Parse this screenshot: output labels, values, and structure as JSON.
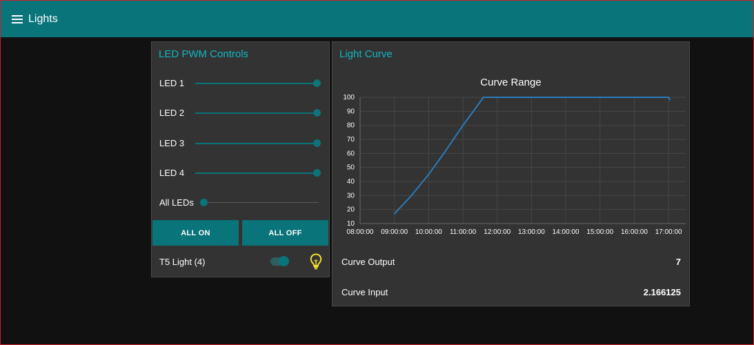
{
  "header": {
    "title": "Lights",
    "menu_icon": "hamburger-menu-icon"
  },
  "led_card": {
    "title": "LED PWM Controls",
    "sliders": [
      {
        "label": "LED 1",
        "value_fraction": 1.0
      },
      {
        "label": "LED 2",
        "value_fraction": 1.0
      },
      {
        "label": "LED 3",
        "value_fraction": 1.0
      },
      {
        "label": "LED 4",
        "value_fraction": 1.0
      },
      {
        "label": "All LEDs",
        "value_fraction": 0.0
      }
    ],
    "all_on_label": "ALL ON",
    "all_off_label": "ALL OFF",
    "t5_label": "T5 Light (4)",
    "t5_state": "on",
    "bulb_icon": "lightbulb-icon",
    "bulb_color": "#f5e12a"
  },
  "curve_card": {
    "title": "Light Curve",
    "curve_output_label": "Curve Output",
    "curve_output_value": "7",
    "curve_input_label": "Curve Input",
    "curve_input_value": "2.166125"
  },
  "colors": {
    "accent": "#097479",
    "title_text": "#0fb8c4",
    "line": "#2a7bbd",
    "card_bg": "#333333",
    "page_bg": "#111111"
  },
  "chart_data": {
    "type": "line",
    "title": "Curve Range",
    "x_tick_labels": [
      "08:00:00",
      "09:00:00",
      "10:00:00",
      "11:00:00",
      "12:00:00",
      "13:00:00",
      "14:00:00",
      "15:00:00",
      "16:00:00",
      "17:00:00"
    ],
    "y_tick_labels": [
      "10",
      "20",
      "30",
      "40",
      "50",
      "60",
      "70",
      "80",
      "90",
      "100"
    ],
    "xlim": [
      8,
      17.5
    ],
    "ylim": [
      10,
      100
    ],
    "grid": true,
    "series": [
      {
        "x": [
          9.0,
          9.5,
          10.0,
          10.5,
          11.0,
          11.6,
          17.0,
          17.05
        ],
        "y": [
          17,
          30,
          45,
          62,
          80,
          100,
          100,
          98
        ]
      }
    ]
  }
}
